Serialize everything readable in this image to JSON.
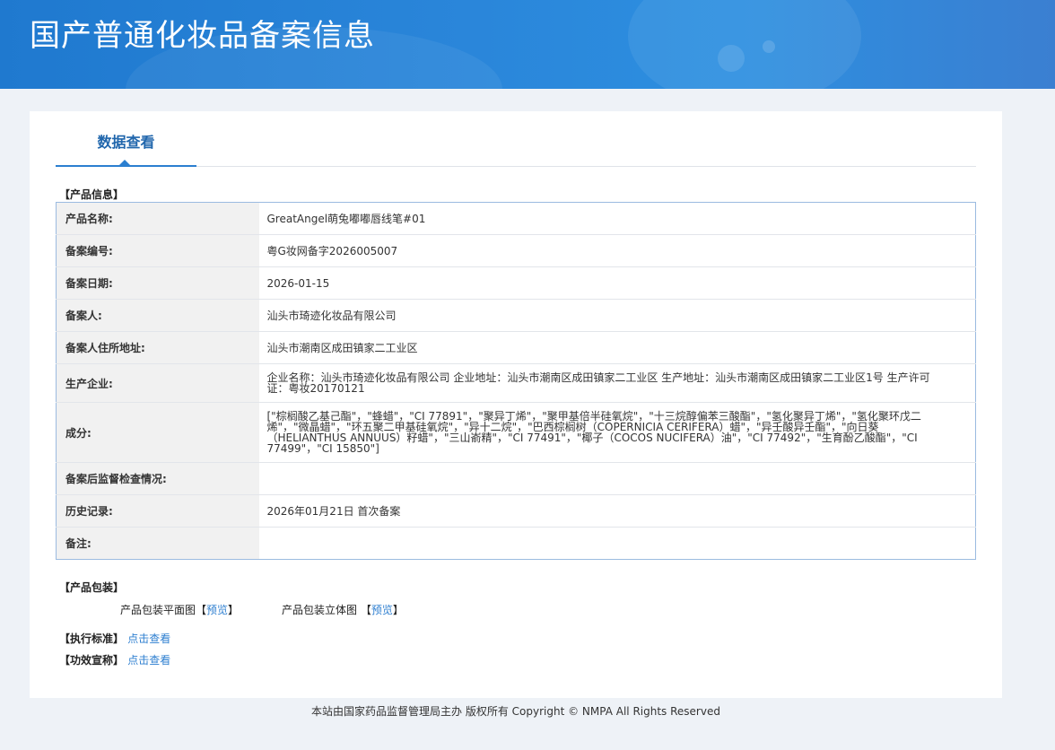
{
  "header": {
    "title": "国产普通化妆品备案信息"
  },
  "tabs": {
    "active_label": "数据查看"
  },
  "product_info": {
    "section_label": "【产品信息】",
    "rows": [
      {
        "key": "产品名称:",
        "value": "GreatAngel萌兔嘟嘟唇线笔#01"
      },
      {
        "key": "备案编号:",
        "value": "粤G妆网备字2026005007"
      },
      {
        "key": "备案日期:",
        "value": "2026-01-15"
      },
      {
        "key": "备案人:",
        "value": "汕头市琦迹化妆品有限公司"
      },
      {
        "key": "备案人住所地址:",
        "value": "汕头市潮南区成田镇家二工业区"
      },
      {
        "key": "生产企业:",
        "value": "企业名称：汕头市琦迹化妆品有限公司 企业地址：汕头市潮南区成田镇家二工业区 生产地址：汕头市潮南区成田镇家二工业区1号 生产许可证：粤妆20170121"
      },
      {
        "key": "成分:",
        "value": "[\"棕榈酸乙基己酯\"，\"蜂蜡\"，\"CI 77891\"，\"聚异丁烯\"，\"聚甲基倍半硅氧烷\"，\"十三烷醇偏苯三酸酯\"，\"氢化聚异丁烯\"，\"氢化聚环戊二烯\"，\"微晶蜡\"，\"环五聚二甲基硅氧烷\"，\"异十二烷\"，\"巴西棕榈树（COPERNICIA CERIFERA）蜡\"，\"异壬酸异壬酯\"，\"向日葵（HELIANTHUS ANNUUS）籽蜡\"，\"三山嵛精\"，\"CI 77491\"，\"椰子（COCOS NUCIFERA）油\"，\"CI 77492\"，\"生育酚乙酸酯\"，\"CI 77499\"，\"CI 15850\"]"
      },
      {
        "key": "备案后监督检查情况:",
        "value": ""
      },
      {
        "key": "历史记录:",
        "value": "2026年01月21日 首次备案"
      },
      {
        "key": "备注:",
        "value": ""
      }
    ]
  },
  "packaging": {
    "section_label": "【产品包装】",
    "flat_label": "产品包装平面图",
    "stereo_label": "产品包装立体图",
    "bracket_open": "【",
    "bracket_close": "】",
    "preview_link": "预览"
  },
  "standard": {
    "label": "【执行标准】",
    "link": "点击查看"
  },
  "claims": {
    "label": "【功效宣称】",
    "link": "点击查看"
  },
  "footer": {
    "text": "本站由国家药品监督管理局主办 版权所有 Copyright © NMPA All Rights Reserved"
  }
}
